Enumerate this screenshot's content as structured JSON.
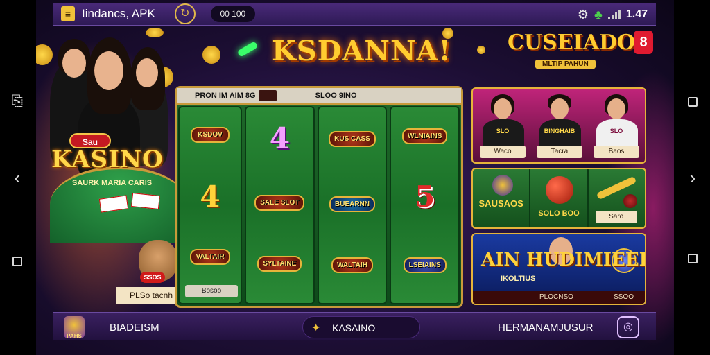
{
  "status_bar": {
    "app_title": "Iindancs, APK",
    "coin_value": "00 100",
    "time": "1.47",
    "icons": [
      "gear-icon",
      "clover-icon",
      "signal-icon"
    ]
  },
  "hero": {
    "badge": "Sau",
    "logo": "KASINO",
    "felt_text": "SAURK MARIA CARIS",
    "bear_badge": "SSOS",
    "label": "PLSo tacnh"
  },
  "main_title": "KSDANNA!",
  "slot": {
    "header_left": "PRON IM AIM 8G",
    "header_right": "SLOO 9INO",
    "footer": "Bosoo",
    "reels": [
      [
        "KSDOV",
        "4",
        "VALTAIR"
      ],
      [
        "4",
        "SALE SLOT",
        "SYLTAINE"
      ],
      [
        "KUS CASS",
        "BUEARNN",
        "WALTAIH"
      ],
      [
        "WLNIAINS",
        "5",
        "LSEIAINS"
      ]
    ]
  },
  "casino_promo": {
    "title": "CUSEIADO",
    "subtitle": "MLTIP PAHUN",
    "badge": "8"
  },
  "live_dealers": [
    {
      "label": "SLO",
      "tag": "Waco"
    },
    {
      "label": "BINGHAIB",
      "tag": "Tacra"
    },
    {
      "label": "SLO",
      "tag": "Baos"
    }
  ],
  "mini_games": {
    "first": "SAUSAOS",
    "second": "SOLO BOO",
    "tag": "Saro"
  },
  "banner": {
    "title": "AIN HUDIMIEED",
    "subtitle": "IKOLTIUS",
    "strip_left": "PLOCNSO",
    "strip_right": "SSOO"
  },
  "bottom_bar": {
    "left_icon_caption": "PAHS",
    "left_label": "BIADEISM",
    "mid_label": "KASAINO",
    "right_label": "HERMANAMJUSUR"
  },
  "colors": {
    "accent_gold": "#ffcc30",
    "frame_purple": "#3a1f63",
    "felt_green": "#1a7028"
  }
}
